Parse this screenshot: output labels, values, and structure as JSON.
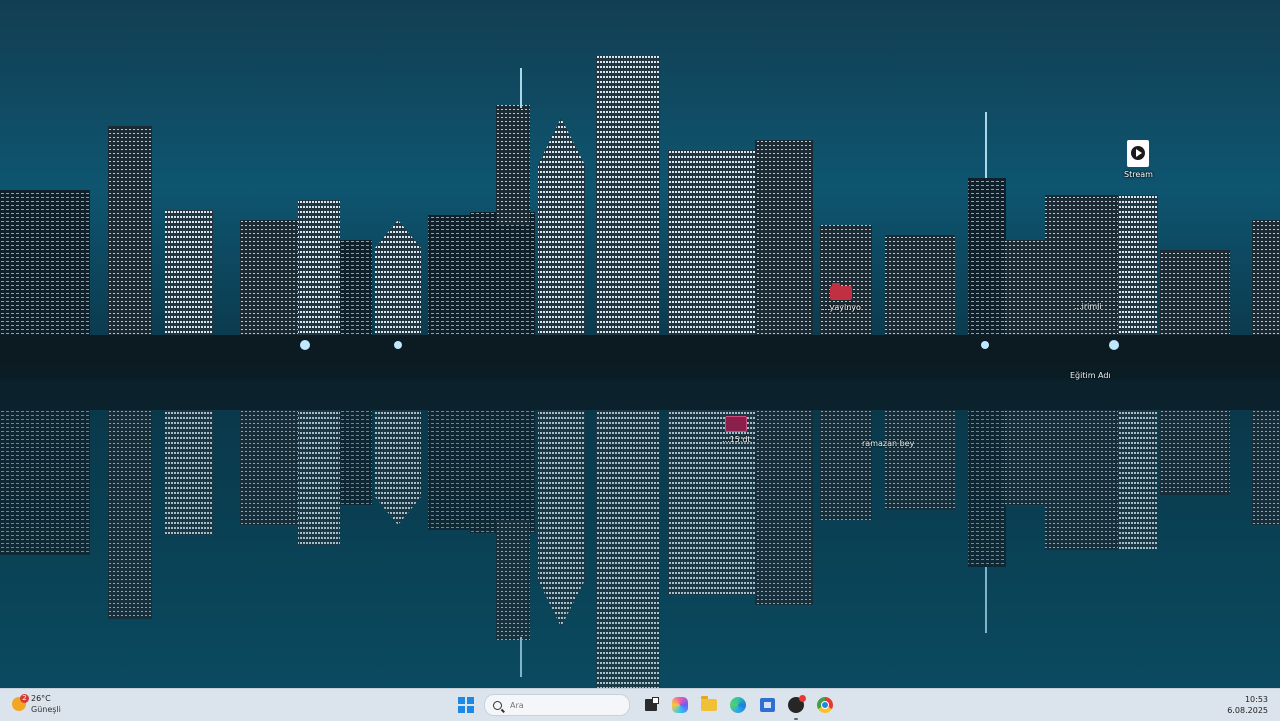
{
  "desktop": {
    "icons": [
      {
        "label": "Stream",
        "icon": "stream-play-icon"
      },
      {
        "label": "...yayinyo",
        "icon": "red-folder-icon"
      },
      {
        "label": "...irimli",
        "icon": "none"
      },
      {
        "label": "Eğitim Adı",
        "icon": "none"
      },
      {
        "label": "...15.dt",
        "icon": "pink-file-icon"
      },
      {
        "label": "ramazan bey",
        "icon": "none"
      }
    ]
  },
  "taskbar": {
    "weather": {
      "temp": "26°C",
      "condition": "Güneşli",
      "badge": "2"
    },
    "search": {
      "placeholder": "Ara"
    },
    "apps": [
      "start-button",
      "search",
      "task-view",
      "copilot",
      "file-explorer",
      "edge",
      "microsoft-store",
      "app-with-notification",
      "chrome"
    ],
    "clock": {
      "time": "10:53",
      "date": "6.08.2025"
    }
  },
  "colors": {
    "taskbar_bg": "#dbe3ec",
    "accent": "#1e88e5",
    "sky": "#0b3a4a"
  }
}
